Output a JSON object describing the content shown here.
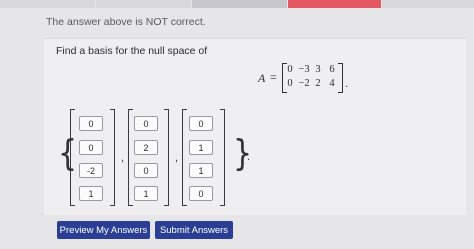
{
  "status": {
    "message": "The answer above is NOT correct."
  },
  "question": {
    "prompt": "Find a basis for the null space of",
    "matrix_label": "A",
    "equals": "=",
    "matrix_rows": [
      [
        "0",
        "−3",
        "3",
        "6"
      ],
      [
        "0",
        "−2",
        "2",
        "4"
      ]
    ],
    "end_punct": "."
  },
  "answer": {
    "open_brace": "{",
    "close_brace": "}",
    "separator": ",",
    "end_punct": ".",
    "vectors": [
      [
        "0",
        "0",
        "-2",
        "1"
      ],
      [
        "0",
        "2",
        "0",
        "1"
      ],
      [
        "0",
        "1",
        "1",
        "0"
      ]
    ]
  },
  "buttons": {
    "preview": "Preview My Answers",
    "submit": "Submit Answers"
  },
  "colors": {
    "button_bg": "#2a3f93",
    "top_bar": [
      "#d9d8db",
      "#d9d8db",
      "#c8c7cb",
      "#e45863",
      "#d9d8db"
    ]
  }
}
